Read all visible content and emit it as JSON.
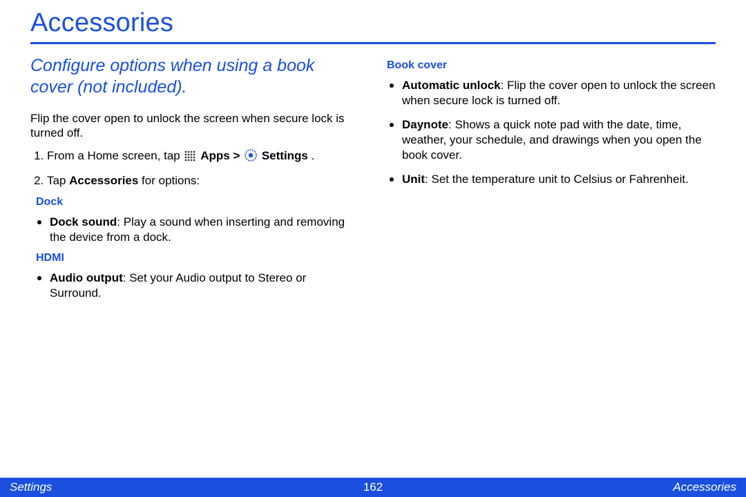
{
  "title": "Accessories",
  "subtitle": "Configure options when using a book cover (not included).",
  "lead": "Flip the cover open to unlock the screen when secure lock is turned off.",
  "step1": {
    "prefix": "From a Home screen, tap ",
    "apps": "Apps",
    "gt": " > ",
    "settings": "Settings",
    "suffix": "."
  },
  "step2": {
    "prefix": "Tap ",
    "bold": "Accessories",
    "suffix": " for options:"
  },
  "dock": {
    "heading": "Dock",
    "item": {
      "bold": "Dock sound",
      "rest": ": Play a sound when inserting and removing the device from a dock."
    }
  },
  "hdmi": {
    "heading": "HDMI",
    "item": {
      "bold": "Audio output",
      "rest": ": Set your Audio output to Stereo or Surround."
    }
  },
  "bookcover": {
    "heading": "Book cover",
    "item1": {
      "bold": "Automatic unlock",
      "rest": ": Flip the cover open to unlock the screen when secure lock is turned off."
    },
    "item2": {
      "bold": "Daynote",
      "rest": ": Shows a quick note pad with the date, time, weather, your schedule, and drawings when you open the book cover."
    },
    "item3": {
      "bold": "Unit",
      "rest": ": Set the temperature unit to Celsius or Fahrenheit."
    }
  },
  "footer": {
    "left": "Settings",
    "center": "162",
    "right": "Accessories"
  }
}
